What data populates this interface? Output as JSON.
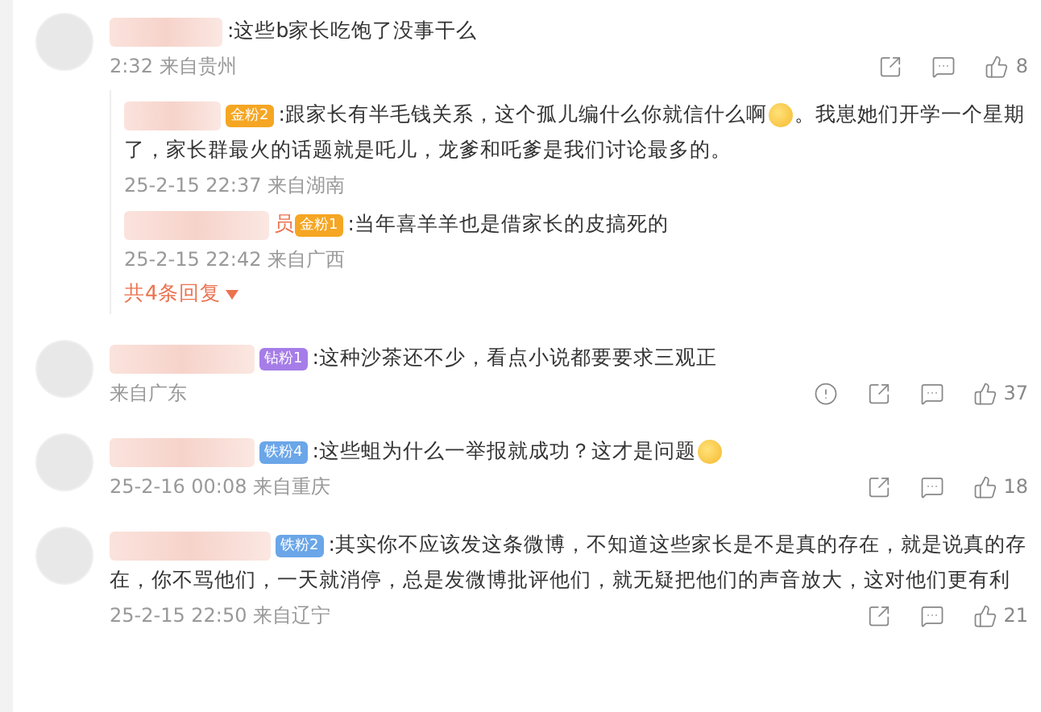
{
  "comments": [
    {
      "parts": [
        {
          "kind": "text",
          "text": ":这些b家长吃饱了没事干么"
        }
      ],
      "meta": "2:32 来自贵州",
      "likes": "8",
      "replies": [
        {
          "badge": {
            "label": "金粉2",
            "color": "#f5a623"
          },
          "parts": [
            {
              "kind": "text",
              "text": ":跟家长有半毛钱关系，这个孤儿编什么你就信什么啊"
            },
            {
              "kind": "emoji"
            },
            {
              "kind": "text",
              "text": "。我崽她们开学一个星期了，家长群最火的话题就是吒儿，龙爹和吒爹是我们讨论最多的。"
            }
          ],
          "meta": "25-2-15 22:37 来自湖南"
        },
        {
          "name_tail": "员",
          "badge": {
            "label": "金粉1",
            "color": "#f5a623"
          },
          "parts": [
            {
              "kind": "text",
              "text": ":当年喜羊羊也是借家长的皮搞死的"
            }
          ],
          "meta": "25-2-15 22:42 来自广西"
        }
      ],
      "more_replies": "共4条回复"
    },
    {
      "badge": {
        "label": "钻粉1",
        "color": "#a67de8"
      },
      "parts": [
        {
          "kind": "text",
          "text": ":这种沙茶还不少，看点小说都要要求三观正"
        }
      ],
      "meta": "来自广东",
      "report": true,
      "likes": "37"
    },
    {
      "badge": {
        "label": "铁粉4",
        "color": "#6aa6e8"
      },
      "parts": [
        {
          "kind": "text",
          "text": ":这些蛆为什么一举报就成功？这才是问题"
        },
        {
          "kind": "emoji"
        }
      ],
      "meta": "25-2-16 00:08 来自重庆",
      "likes": "18"
    },
    {
      "badge": {
        "label": "铁粉2",
        "color": "#6aa6e8"
      },
      "parts": [
        {
          "kind": "text",
          "text": ":其实你不应该发这条微博，不知道这些家长是不是真的存在，就是说真的存在，你不骂他们，一天就消停，总是发微博批评他们，就无疑把他们的声音放大，这对他们更有利"
        }
      ],
      "meta": "25-2-15 22:50 来自辽宁",
      "likes": "21"
    }
  ]
}
